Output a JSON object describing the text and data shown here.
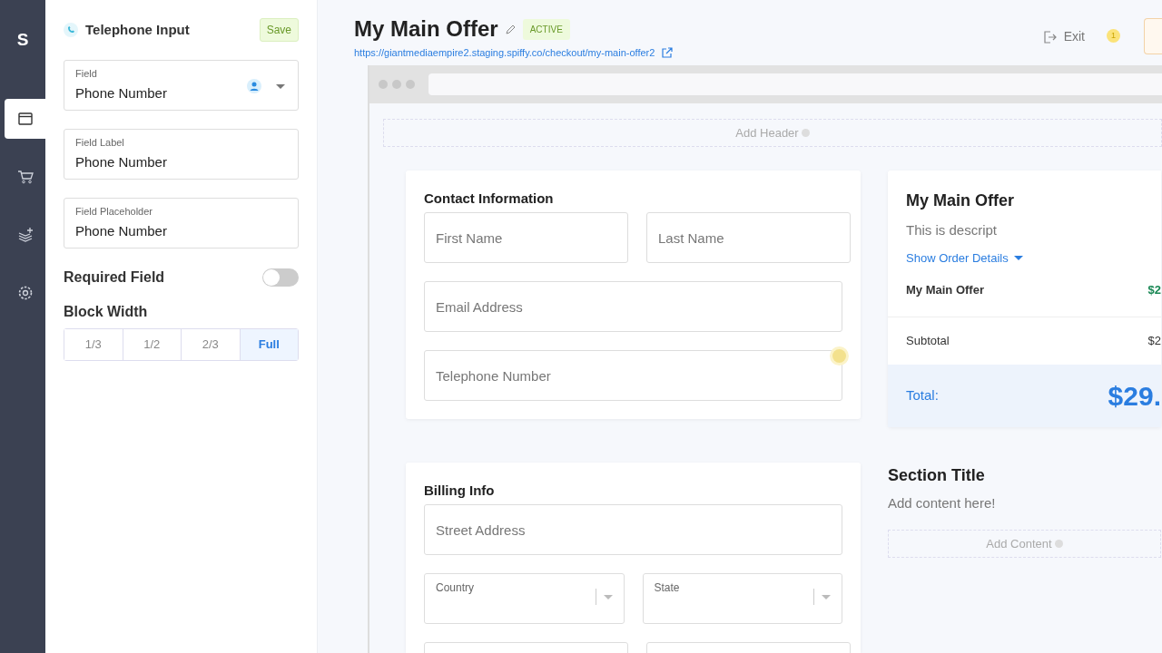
{
  "rail": {
    "logo": "S",
    "items": [
      {
        "kind": "window",
        "selected": true
      },
      {
        "kind": "cart",
        "selected": false
      },
      {
        "kind": "layers",
        "selected": false
      },
      {
        "kind": "gear",
        "selected": false
      }
    ]
  },
  "panel": {
    "title": "Telephone Input",
    "save": "Save",
    "fields": [
      {
        "kind": "select",
        "label": "Field",
        "value": "Phone Number"
      },
      {
        "kind": "text",
        "label": "Field Label",
        "value": "Phone Number"
      },
      {
        "kind": "text",
        "label": "Field Placeholder",
        "value": "Phone Number"
      }
    ],
    "required": {
      "label": "Required Field",
      "on": false
    },
    "block_width": {
      "label": "Block Width",
      "options": [
        {
          "label": "1/3",
          "selected": false
        },
        {
          "label": "1/2",
          "selected": false
        },
        {
          "label": "2/3",
          "selected": false
        },
        {
          "label": "Full",
          "selected": true
        }
      ]
    }
  },
  "header": {
    "title": "My Main Offer",
    "status": "ACTIVE",
    "url": "https://giantmediaempire2.staging.spiffy.co/checkout/my-main-offer2",
    "exit": "Exit",
    "notice": "1"
  },
  "preview": {
    "add_header": "Add Header",
    "contact": {
      "title": "Contact Information",
      "rows": [
        [
          {
            "kind": "input",
            "placeholder": "First Name",
            "warning": false
          },
          {
            "kind": "input",
            "placeholder": "Last Name",
            "warning": false
          }
        ],
        [
          {
            "kind": "input",
            "placeholder": "Email Address",
            "warning": false
          }
        ],
        [
          {
            "kind": "input",
            "placeholder": "Telephone Number",
            "warning": true
          }
        ]
      ]
    },
    "billing": {
      "title": "Billing Info",
      "rows": [
        [
          {
            "kind": "input",
            "placeholder": "Street Address",
            "warning": false
          }
        ],
        [
          {
            "kind": "select",
            "label": "Country",
            "warning": false
          },
          {
            "kind": "select",
            "label": "State",
            "warning": false
          }
        ],
        [
          {
            "kind": "input",
            "warning": false
          },
          {
            "kind": "input",
            "warning": false
          }
        ]
      ]
    },
    "summary": {
      "title": "My Main Offer",
      "description": "This is descript",
      "toggle": "Show Order Details",
      "item": {
        "name": "My Main Offer",
        "price": "$2"
      },
      "subtotal": {
        "label": "Subtotal",
        "value": "$2"
      },
      "total": {
        "label": "Total:",
        "value": "$29."
      }
    },
    "section": {
      "title": "Section Title",
      "text": "Add content here!",
      "add": "Add Content"
    }
  }
}
